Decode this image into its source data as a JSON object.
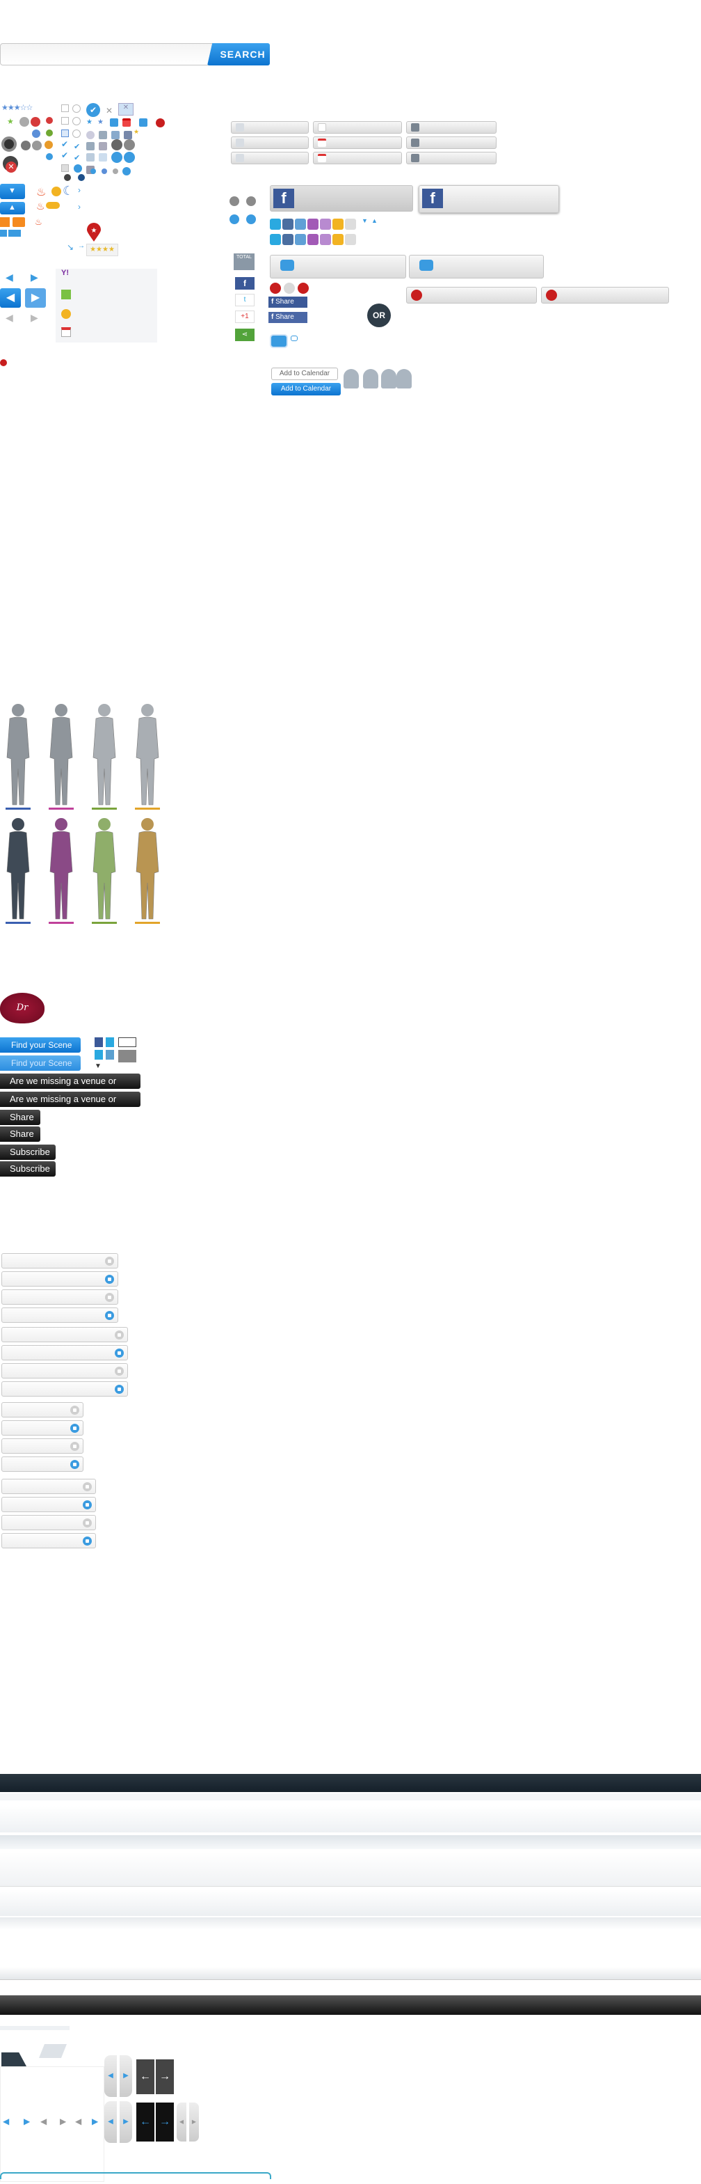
{
  "search": {
    "placeholder": "",
    "button_label": "SEARCH"
  },
  "social": {
    "total_label": "TOTAL",
    "share_label": "Share",
    "gplus_label": "+1",
    "or_label": "OR",
    "add_to_calendar": "Add to Calendar",
    "add_to_calendar_active": "Add to Calendar"
  },
  "brand": {
    "logo_text": "Dr Pepper"
  },
  "scene": {
    "find_label": "Find your Scene",
    "find_label_2": "Find your Scene",
    "missing_label": "Are we missing a venue or event?",
    "missing_label_2": "Are we missing a venue or event?",
    "share_label": "Share",
    "share_label_2": "Share",
    "subscribe_label": "Subscribe",
    "subscribe_label_2": "Subscribe"
  },
  "colors": {
    "accent_blue": "#0d74d0",
    "dark_bar": "#1f2a33",
    "facebook": "#3b5998",
    "twitter": "#2aa9e0",
    "red_marker": "#c81e1e",
    "people_underline": [
      "#3a5fb0",
      "#c0419a",
      "#7aa33c",
      "#e2a42a"
    ]
  },
  "icons": [
    "star-rating-icon",
    "map-pin-icon",
    "calendar-icon",
    "checkmark-icon",
    "flame-icon",
    "moon-icon",
    "arrow-left-icon",
    "arrow-right-icon",
    "facebook-icon",
    "twitter-icon",
    "google-plus-icon",
    "share-icon",
    "email-icon",
    "print-icon",
    "speech-bubble-icon",
    "person-silhouette-icon"
  ]
}
